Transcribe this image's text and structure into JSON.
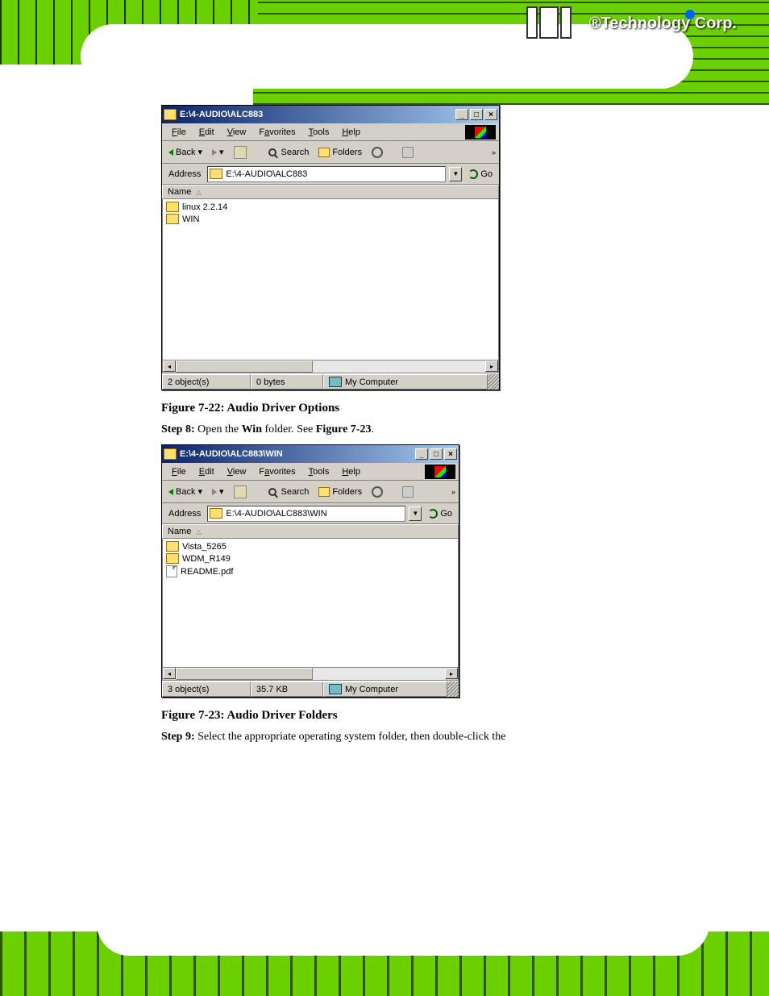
{
  "logo_text": "®Technology Corp.",
  "captions": {
    "fig1": "Figure 7-22: Audio Driver Options",
    "step8": "Step 8:",
    "step8_text": " Open the ",
    "step8_dir": "Win",
    "step8_text2": " folder. See ",
    "step8_ref": "Figure 7-23",
    "step8_text3": ".",
    "fig2": "Figure 7-23: Audio Driver Folders",
    "step9": "Step 9:",
    "step9_text": " Select the appropriate operating system folder, then double-click the"
  },
  "window1": {
    "title": "E:\\4-AUDIO\\ALC883",
    "menu": [
      "File",
      "Edit",
      "View",
      "Favorites",
      "Tools",
      "Help"
    ],
    "back": "Back",
    "search": "Search",
    "folders": "Folders",
    "address_label": "Address",
    "address": "E:\\4-AUDIO\\ALC883",
    "go": "Go",
    "colhead": "Name",
    "items": [
      {
        "name": "linux 2.2.14",
        "type": "folder"
      },
      {
        "name": "WIN",
        "type": "folder"
      }
    ],
    "status_objects": "2 object(s)",
    "status_size": "0 bytes",
    "status_loc": "My Computer"
  },
  "window2": {
    "title": "E:\\4-AUDIO\\ALC883\\WIN",
    "menu": [
      "File",
      "Edit",
      "View",
      "Favorites",
      "Tools",
      "Help"
    ],
    "back": "Back",
    "search": "Search",
    "folders": "Folders",
    "address_label": "Address",
    "address": "E:\\4-AUDIO\\ALC883\\WIN",
    "go": "Go",
    "colhead": "Name",
    "items": [
      {
        "name": "Vista_5265",
        "type": "folder"
      },
      {
        "name": "WDM_R149",
        "type": "folder"
      },
      {
        "name": "README.pdf",
        "type": "pdf"
      }
    ],
    "status_objects": "3 object(s)",
    "status_size": "35.7 KB",
    "status_loc": "My Computer"
  }
}
